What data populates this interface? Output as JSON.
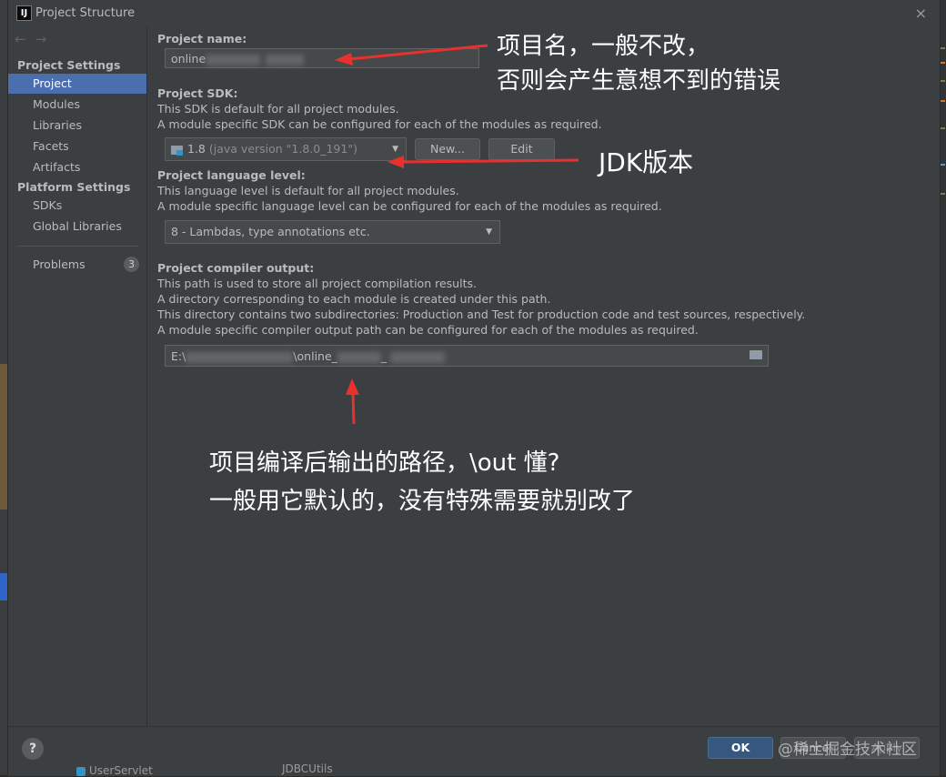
{
  "window": {
    "title": "Project Structure",
    "close": "×"
  },
  "sidebar": {
    "nav_back": "←",
    "nav_forward": "→",
    "section_project_settings": "Project Settings",
    "items_project": [
      {
        "label": "Project",
        "selected": true
      },
      {
        "label": "Modules"
      },
      {
        "label": "Libraries"
      },
      {
        "label": "Facets"
      },
      {
        "label": "Artifacts"
      }
    ],
    "section_platform_settings": "Platform Settings",
    "items_platform": [
      {
        "label": "SDKs"
      },
      {
        "label": "Global Libraries"
      }
    ],
    "problems": {
      "label": "Problems",
      "count": "3"
    }
  },
  "project_name": {
    "title": "Project name:",
    "value": "online"
  },
  "project_sdk": {
    "title": "Project SDK:",
    "desc1": "This SDK is default for all project modules.",
    "desc2": "A module specific SDK can be configured for each of the modules as required.",
    "selected_version": "1.8",
    "selected_detail": "(java version \"1.8.0_191\")",
    "new_button": "New...",
    "edit_button": "Edit"
  },
  "language_level": {
    "title": "Project language level:",
    "desc1": "This language level is default for all project modules.",
    "desc2": "A module specific language level can be configured for each of the modules as required.",
    "selected": "8 - Lambdas, type annotations etc."
  },
  "compiler_output": {
    "title": "Project compiler output:",
    "desc1": "This path is used to store all project compilation results.",
    "desc2": "A directory corresponding to each module is created under this path.",
    "desc3": "This directory contains two subdirectories: Production and Test for production code and test sources, respectively.",
    "desc4": "A module specific compiler output path can be configured for each of the modules as required.",
    "path_prefix": "E:\\",
    "path_middle": "\\online_",
    "path_sep": "_"
  },
  "annotations": {
    "name_line1": "项目名，一般不改，",
    "name_line2": "否则会产生意想不到的错误",
    "sdk": "JDK版本",
    "output_line1": "项目编译后输出的路径，\\out 懂?",
    "output_line2": "一般用它默认的，没有特殊需要就别改了"
  },
  "bottom": {
    "help": "?",
    "ok": "OK",
    "cancel": "Cancel",
    "apply": "Apply",
    "watermark": "@稀土掘金技术社区"
  },
  "underlay": {
    "item1": "UserServlet",
    "item2": "JDBCUtils"
  },
  "colors": {
    "selection": "#4b6eaf",
    "arrow": "#e8312f",
    "ok_button": "#365880"
  }
}
